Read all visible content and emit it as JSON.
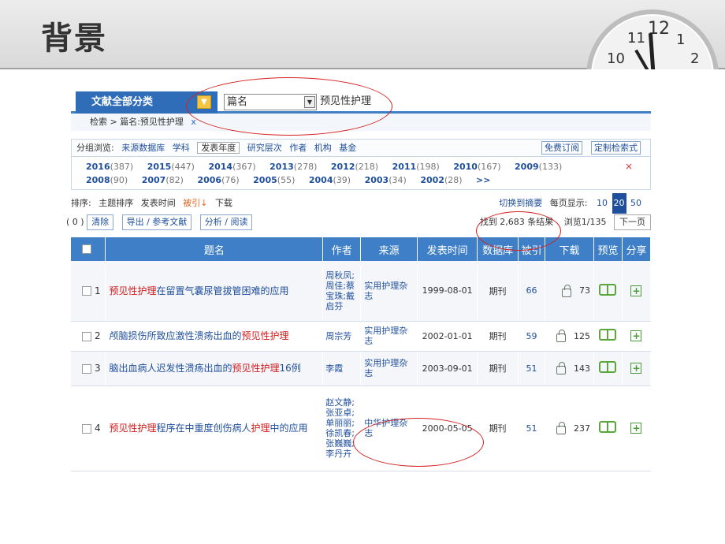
{
  "slide": {
    "title": "背景"
  },
  "clock": {
    "numbers": [
      "10",
      "11",
      "12",
      "1",
      "2"
    ]
  },
  "topbar": {
    "category_label": "文献全部分类",
    "field_value": "篇名",
    "search_value": "预见性护理"
  },
  "breadcrumb": {
    "text": "检索 > 篇名:预见性护理",
    "remove": "x"
  },
  "group_browse": {
    "label": "分组浏览:",
    "options": [
      "来源数据库",
      "学科",
      "发表年度",
      "研究层次",
      "作者",
      "机构",
      "基金"
    ],
    "active": "发表年度",
    "subscribe": "免费订阅",
    "custom_query": "定制检索式"
  },
  "years": [
    {
      "year": "2016",
      "count": "(387)"
    },
    {
      "year": "2015",
      "count": "(447)"
    },
    {
      "year": "2014",
      "count": "(367)"
    },
    {
      "year": "2013",
      "count": "(278)"
    },
    {
      "year": "2012",
      "count": "(218)"
    },
    {
      "year": "2011",
      "count": "(198)"
    },
    {
      "year": "2010",
      "count": "(167)"
    },
    {
      "year": "2009",
      "count": "(133)"
    },
    {
      "year": "2008",
      "count": "(90)"
    },
    {
      "year": "2007",
      "count": "(82)"
    },
    {
      "year": "2006",
      "count": "(76)"
    },
    {
      "year": "2005",
      "count": "(55)"
    },
    {
      "year": "2004",
      "count": "(39)"
    },
    {
      "year": "2003",
      "count": "(34)"
    },
    {
      "year": "2002",
      "count": "(28)"
    }
  ],
  "years_more": ">>",
  "years_close": "×",
  "sort": {
    "label": "排序:",
    "options": [
      "主题排序",
      "发表时间",
      "被引",
      "下载"
    ],
    "active": "被引",
    "arrow": "↓",
    "switch_summary": "切换到摘要",
    "per_page_label": "每页显示:",
    "per_page": [
      "10",
      "20",
      "50"
    ],
    "per_page_selected": "20"
  },
  "actions": {
    "count": "( 0 )",
    "clear": "清除",
    "export": "导出 / 参考文献",
    "analyze": "分析 / 阅读",
    "found": "找到 2,683 条结果",
    "browse": "浏览1/135",
    "next": "下一页"
  },
  "table": {
    "headers": [
      "题名",
      "作者",
      "来源",
      "发表时间",
      "数据库",
      "被引",
      "下载",
      "预览",
      "分享"
    ],
    "rows": [
      {
        "num": "1",
        "title_hl": "预见性护理",
        "title_rest": "在留置气囊尿管拔管困难的应用",
        "title_hl2": "",
        "title_tail": "",
        "authors": "周秋凤;周佳;蔡宝珠;戴启芬",
        "source": "实用护理杂志",
        "date": "1999-08-01",
        "db": "期刊",
        "cited": "66",
        "downloads": "73"
      },
      {
        "num": "2",
        "title_hl": "",
        "title_rest": "颅脑损伤所致应激性溃疡出血的",
        "title_hl2": "预见性护理",
        "title_tail": "",
        "authors": "周宗芳",
        "source": "实用护理杂志",
        "date": "2002-01-01",
        "db": "期刊",
        "cited": "59",
        "downloads": "125"
      },
      {
        "num": "3",
        "title_hl": "",
        "title_rest": "脑出血病人迟发性溃疡出血的",
        "title_hl2": "预见性护理",
        "title_tail": "16例",
        "authors": "李霞",
        "source": "实用护理杂志",
        "date": "2003-09-01",
        "db": "期刊",
        "cited": "51",
        "downloads": "143"
      },
      {
        "num": "4",
        "title_hl": "预见性护理",
        "title_rest": "程序在中重度创伤病人",
        "title_hl2": "护理",
        "title_tail": "中的应用",
        "authors": "赵文静;张亚卓;单丽丽;徐凯春;张巍巍;李丹卉",
        "source": "中华护理杂志",
        "date": "2000-05-05",
        "db": "期刊",
        "cited": "51",
        "downloads": "237"
      }
    ]
  },
  "colors": {
    "accent": "#3f7fc7",
    "highlight": "#d21a1a",
    "annotation": "#d52020"
  }
}
